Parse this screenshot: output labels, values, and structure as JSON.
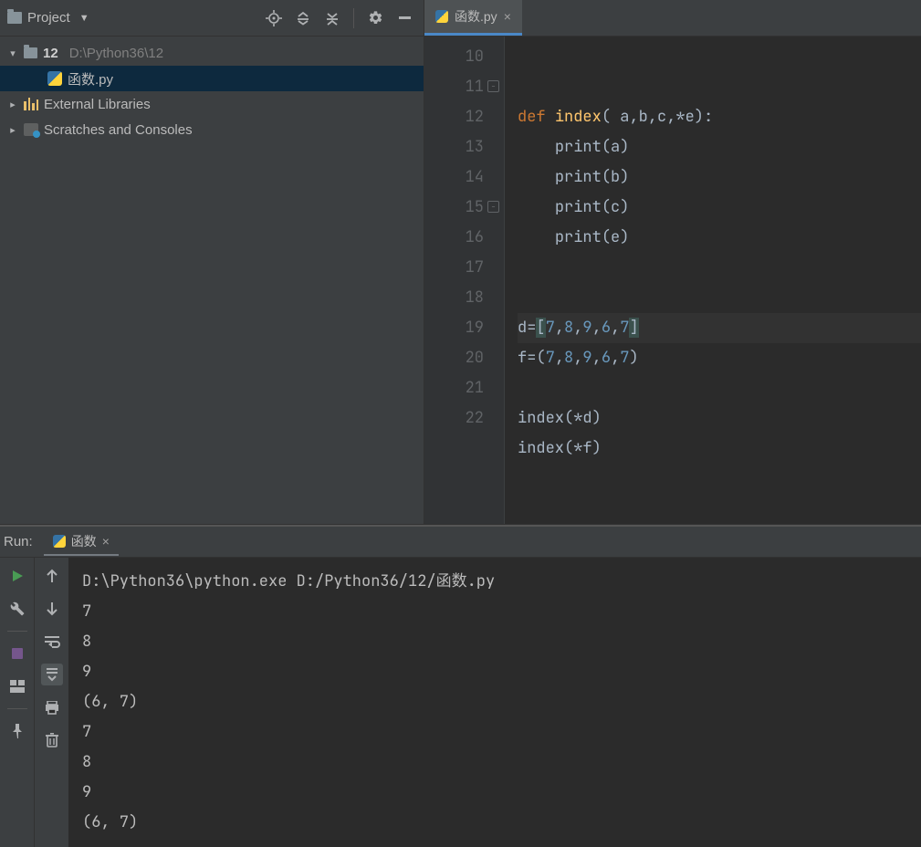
{
  "project_panel": {
    "title": "Project",
    "root": {
      "name": "12",
      "path": "D:\\Python36\\12"
    },
    "file": "函数.py",
    "external_libraries": "External Libraries",
    "scratches": "Scratches and Consoles"
  },
  "editor": {
    "tab_label": "函数.py",
    "line_numbers": [
      "10",
      "11",
      "12",
      "13",
      "14",
      "15",
      "16",
      "17",
      "18",
      "19",
      "20",
      "21",
      "22"
    ],
    "code": {
      "l10": "",
      "l11_kw": "def",
      "l11_fn": "index",
      "l11_sig": "( a,b,c,*e):",
      "l12": "print",
      "l12_arg": "(a)",
      "l13": "print",
      "l13_arg": "(b)",
      "l14": "print",
      "l14_arg": "(c)",
      "l15": "print",
      "l15_arg": "(e)",
      "l18_lhs": "d=",
      "l18_lb": "[",
      "l18_n1": "7",
      "l18_c1": ",",
      "l18_n2": "8",
      "l18_c2": ",",
      "l18_n3": "9",
      "l18_c3": ",",
      "l18_n4": "6",
      "l18_c4": ",",
      "l18_n5": "7",
      "l18_rb": "]",
      "l19_lhs": "f=(",
      "l19_n1": "7",
      "l19_c1": ",",
      "l19_n2": "8",
      "l19_c2": ",",
      "l19_n3": "9",
      "l19_c3": ",",
      "l19_n4": "6",
      "l19_c4": ",",
      "l19_n5": "7",
      "l19_rp": ")",
      "l21": "index(*d)",
      "l22": "index(*f)"
    }
  },
  "run": {
    "label": "Run:",
    "tab_label": "函数",
    "output": "D:\\Python36\\python.exe D:/Python36/12/函数.py\n7\n8\n9\n(6, 7)\n7\n8\n9\n(6, 7)"
  }
}
